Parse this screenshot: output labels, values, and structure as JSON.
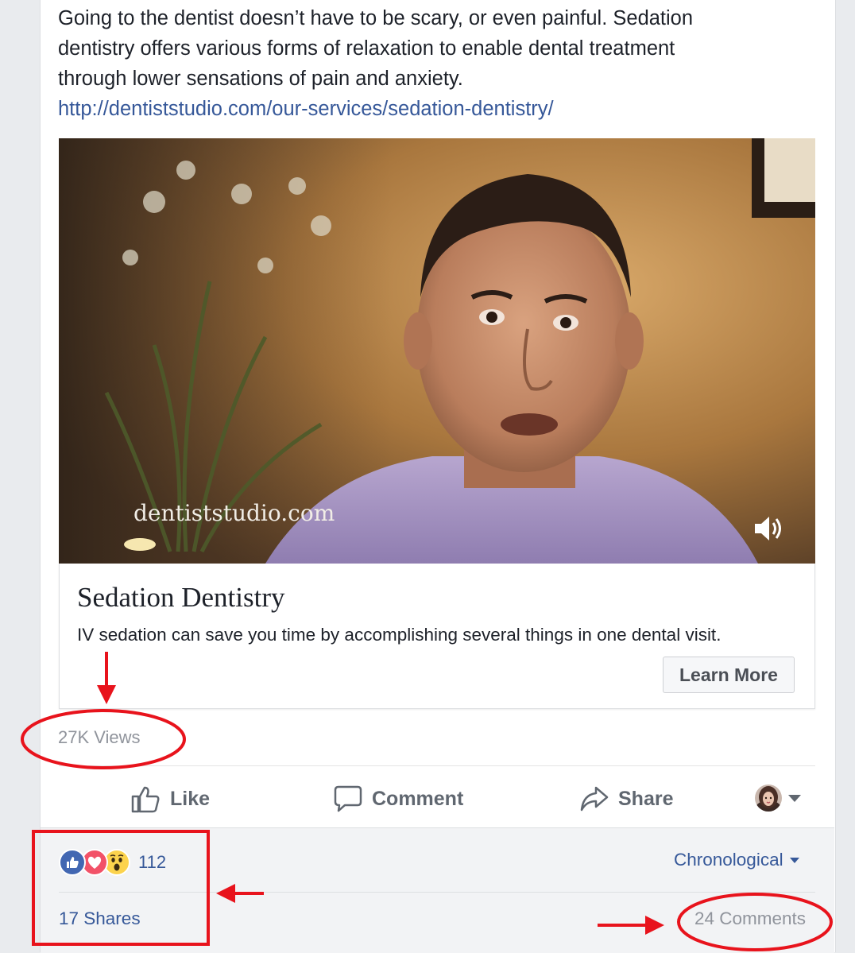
{
  "post": {
    "text_lines": [
      "Going to the dentist doesn’t have to be scary, or even painful. Sedation",
      "dentistry offers various forms of relaxation to enable dental treatment",
      "through lower sensations of pain and anxiety."
    ],
    "link": "http://dentiststudio.com/our-services/sedation-dentistry/"
  },
  "video": {
    "watermark": "dentiststudio.com",
    "sound_icon": "speaker-volume-icon"
  },
  "attachment": {
    "title": "Sedation Dentistry",
    "description": "IV sedation can save you time by accomplishing several things in one dental visit.",
    "cta_label": "Learn More"
  },
  "stats": {
    "views": "27K Views",
    "reaction_count": "112",
    "reactions": [
      "like",
      "love",
      "wow"
    ],
    "shares": "17 Shares",
    "comments": "24 Comments"
  },
  "actions": {
    "like": "Like",
    "comment": "Comment",
    "share": "Share"
  },
  "sort": {
    "label": "Chronological"
  },
  "colors": {
    "link": "#365899",
    "annotation": "#e8131c",
    "like_blue": "#4267b2",
    "love_red": "#f25268",
    "wow_yellow": "#fcd34d"
  }
}
